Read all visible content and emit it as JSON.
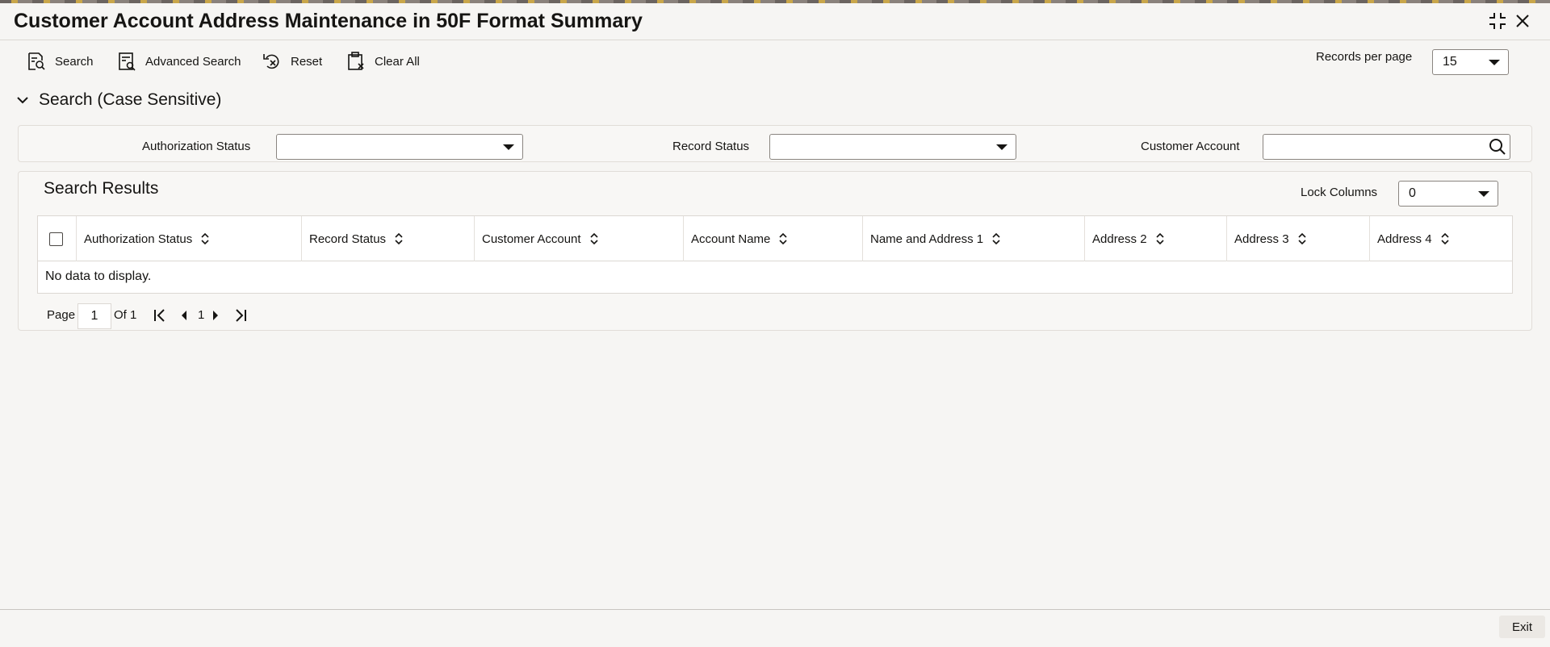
{
  "window": {
    "title": "Customer Account Address Maintenance in 50F Format Summary"
  },
  "toolbar": {
    "search_label": "Search",
    "advanced_search_label": "Advanced Search",
    "reset_label": "Reset",
    "clear_all_label": "Clear All",
    "records_per_page_label": "Records per page",
    "records_per_page_value": "15"
  },
  "search_section": {
    "title": "Search (Case Sensitive)",
    "authorization_status_label": "Authorization Status",
    "authorization_status_value": "",
    "record_status_label": "Record Status",
    "record_status_value": "",
    "customer_account_label": "Customer Account",
    "customer_account_value": ""
  },
  "results": {
    "title": "Search Results",
    "lock_columns_label": "Lock Columns",
    "lock_columns_value": "0",
    "columns": [
      "Authorization Status",
      "Record Status",
      "Customer Account",
      "Account Name",
      "Name and Address 1",
      "Address 2",
      "Address 3",
      "Address 4"
    ],
    "empty_text": "No data to display."
  },
  "pagination": {
    "page_label": "Page",
    "page_value": "1",
    "of_label": "Of 1",
    "current_page": "1"
  },
  "footer": {
    "exit_label": "Exit"
  }
}
